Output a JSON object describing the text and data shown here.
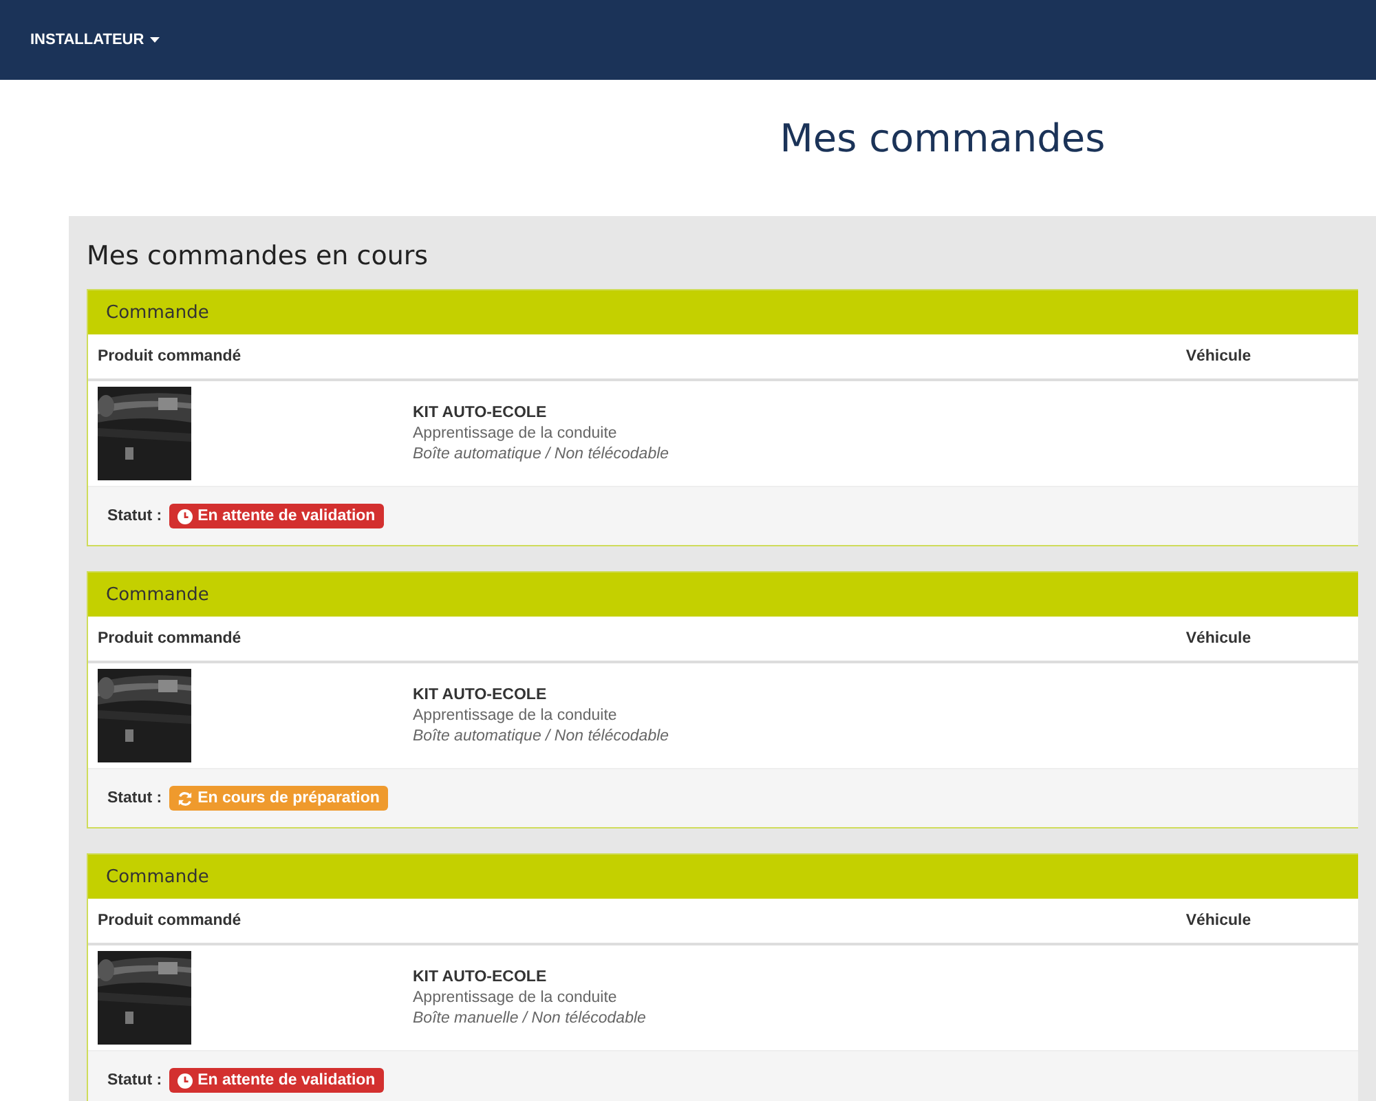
{
  "nav": {
    "menu": "INSTALLATEUR"
  },
  "title": "Mes commandes",
  "panel": {
    "title": "Mes commandes en cours",
    "orders": [
      {
        "heading": "Commande",
        "columns": [
          "Produit commandé",
          "Véhicule"
        ],
        "product": {
          "name": "KIT AUTO-ECOLE",
          "subtitle": "Apprentissage de la conduite",
          "options": "Boîte automatique / Non télécodable"
        },
        "status_label": "Statut :",
        "status": {
          "kind": "waiting",
          "text": "En attente de validation"
        }
      },
      {
        "heading": "Commande",
        "columns": [
          "Produit commandé",
          "Véhicule"
        ],
        "product": {
          "name": "KIT AUTO-ECOLE",
          "subtitle": "Apprentissage de la conduite",
          "options": "Boîte automatique / Non télécodable"
        },
        "status_label": "Statut :",
        "status": {
          "kind": "preparing",
          "text": "En cours de préparation"
        }
      },
      {
        "heading": "Commande",
        "columns": [
          "Produit commandé",
          "Véhicule"
        ],
        "product": {
          "name": "KIT AUTO-ECOLE",
          "subtitle": "Apprentissage de la conduite",
          "options": "Boîte manuelle / Non télécodable"
        },
        "status_label": "Statut :",
        "status": {
          "kind": "waiting",
          "text": "En attente de validation"
        }
      }
    ]
  }
}
